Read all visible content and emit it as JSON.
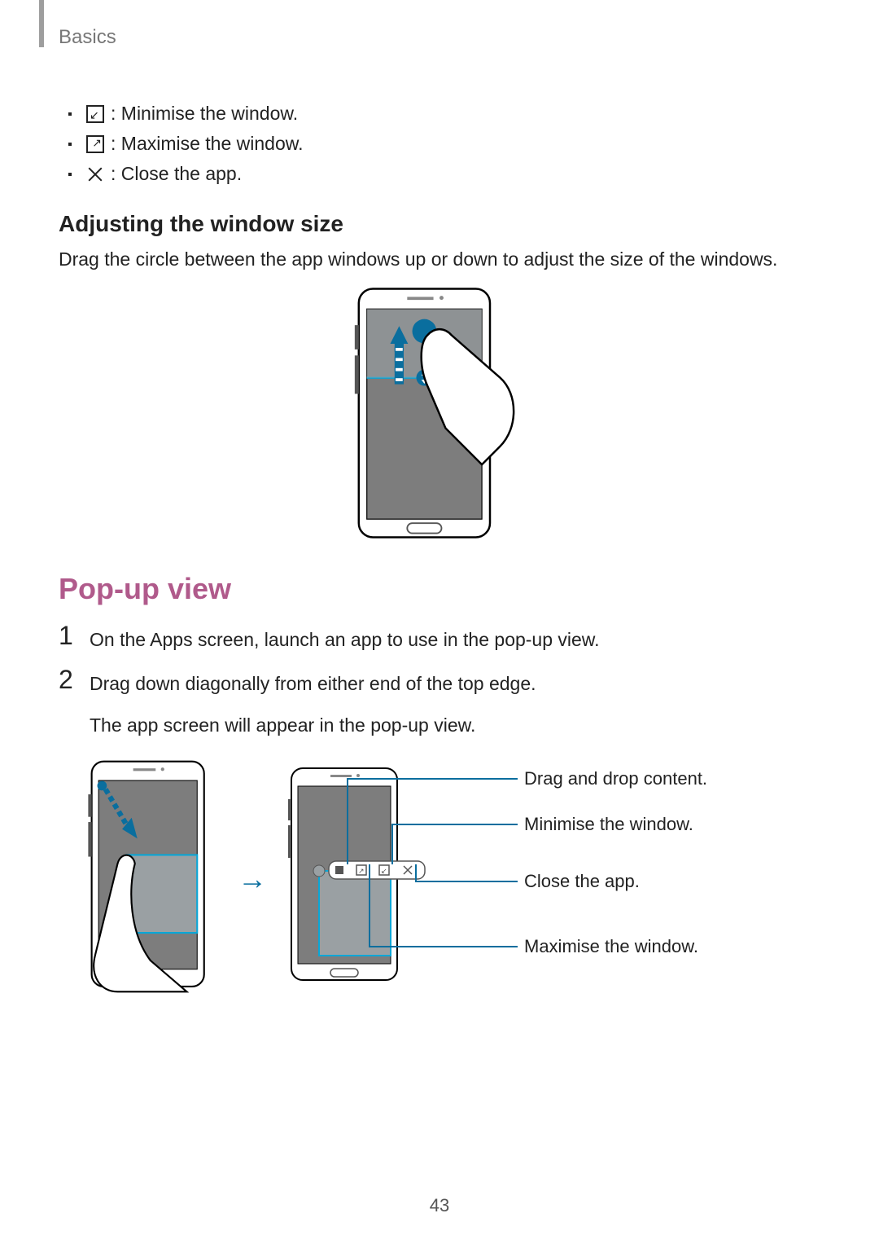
{
  "chapter": "Basics",
  "icon_list": [
    {
      "icon": "minimise",
      "label": ": Minimise the window."
    },
    {
      "icon": "maximise",
      "label": ": Maximise the window."
    },
    {
      "icon": "close",
      "label": ": Close the app."
    }
  ],
  "subhead": "Adjusting the window size",
  "subhead_body": "Drag the circle between the app windows up or down to adjust the size of the windows.",
  "section": "Pop-up view",
  "steps": [
    {
      "num": "1",
      "text": "On the Apps screen, launch an app to use in the pop-up view."
    },
    {
      "num": "2",
      "text": "Drag down diagonally from either end of the top edge.",
      "text2": "The app screen will appear in the pop-up view."
    }
  ],
  "callouts": {
    "drag": "Drag and drop content.",
    "minimise": "Minimise the window.",
    "close": "Close the app.",
    "maximise": "Maximise the window."
  },
  "page_number": "43"
}
